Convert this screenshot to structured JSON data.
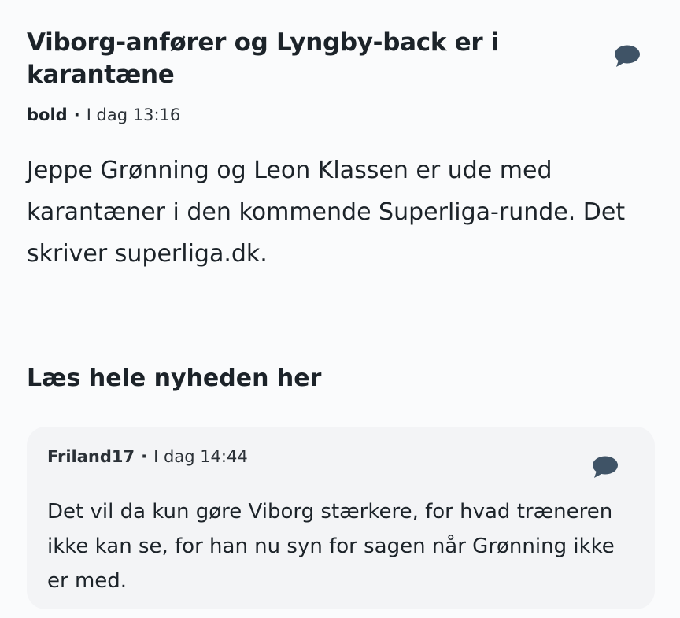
{
  "article": {
    "title": "Viborg-anfører og Lyngby-back er i karantæne",
    "source": "bold",
    "separator": "·",
    "time": "I dag 13:16",
    "body": "Jeppe Grønning og Leon Klassen er ude med karantæner i den kommende Superliga-runde. Det skriver superliga.dk.",
    "comment_icon": "speech-bubble-icon"
  },
  "read_more": {
    "label": "Læs hele nyheden her"
  },
  "comment": {
    "author": "Friland17",
    "separator": "·",
    "time": "I dag 14:44",
    "text": "Det vil da kun gøre Viborg stærkere, for hvad træneren ikke kan se, for han nu syn for sagen når Grønning ikke er med.",
    "comment_icon": "speech-bubble-icon"
  },
  "colors": {
    "background": "#fafbfc",
    "card": "#f3f4f6",
    "text": "#1c2329",
    "icon": "#3f5366"
  }
}
